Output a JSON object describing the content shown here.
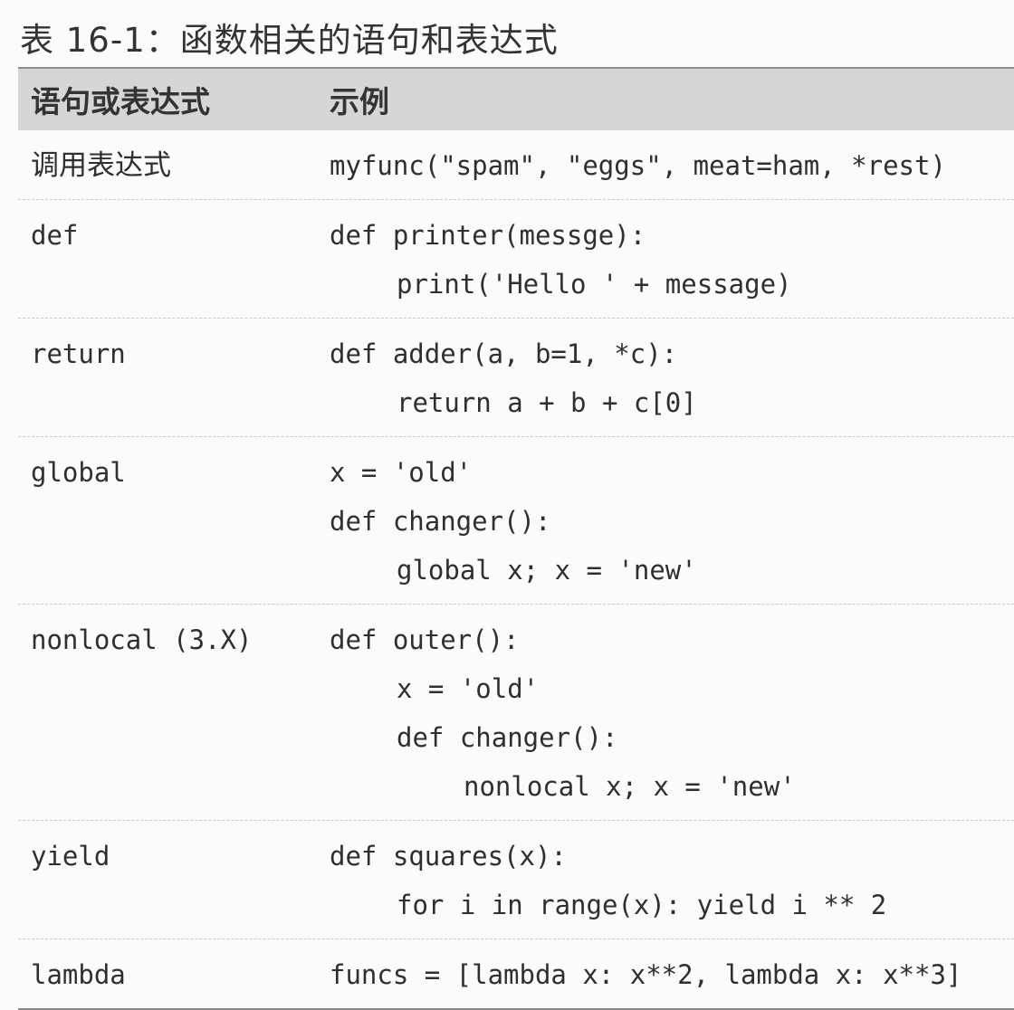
{
  "caption": "表 16-1：函数相关的语句和表达式",
  "table": {
    "headers": {
      "statement": "语句或表达式",
      "example": "示例"
    },
    "rows": [
      {
        "statement": "调用表达式",
        "code": [
          "myfunc(\"spam\", \"eggs\", meat=ham, *rest)"
        ]
      },
      {
        "statement": "def",
        "code": [
          "def printer(messge):",
          "print('Hello ' + message)"
        ]
      },
      {
        "statement": "return",
        "code": [
          "def adder(a, b=1, *c):",
          "return a + b + c[0]"
        ]
      },
      {
        "statement": "global",
        "code": [
          "x = 'old'",
          "def changer():",
          "global x; x = 'new'"
        ]
      },
      {
        "statement": "nonlocal (3.X)",
        "code": [
          "def outer():",
          "x = 'old'",
          "def changer():",
          "nonlocal x; x = 'new'"
        ]
      },
      {
        "statement": "yield",
        "code": [
          "def squares(x):",
          "for i in range(x): yield i ** 2"
        ]
      },
      {
        "statement": "lambda",
        "code": [
          "funcs = [lambda x: x**2, lambda x: x**3]"
        ]
      }
    ]
  }
}
